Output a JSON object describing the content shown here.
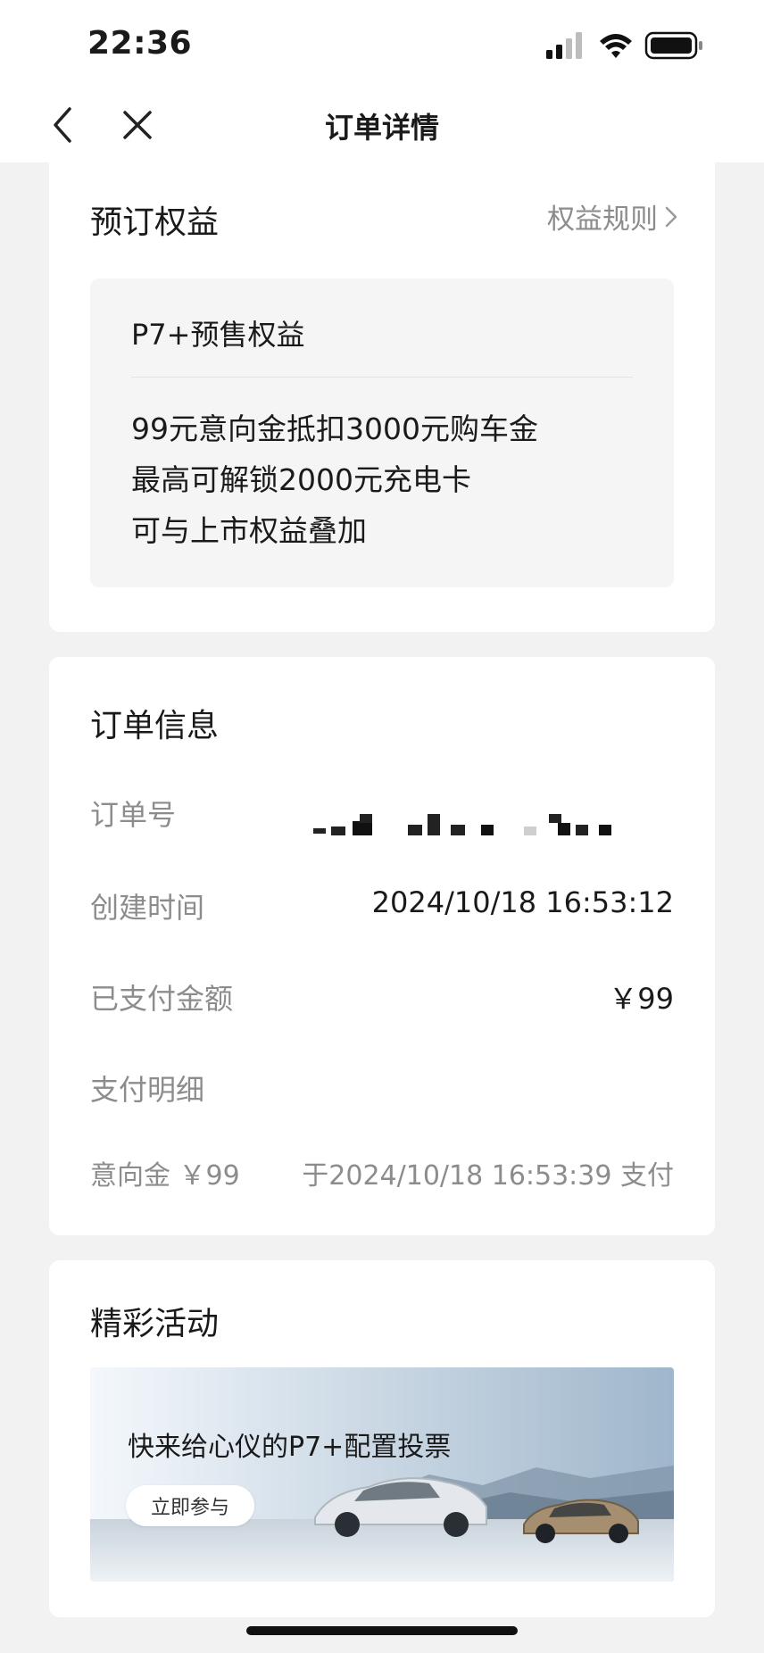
{
  "status_bar": {
    "time": "22:36"
  },
  "nav": {
    "title": "订单详情",
    "back_icon": "chevron-left-icon",
    "close_icon": "close-icon"
  },
  "benefits_card": {
    "title": "预订权益",
    "rules_link": "权益规则",
    "box_title": "P7+预售权益",
    "lines": [
      "99元意向金抵扣3000元购车金",
      "最高可解锁2000元充电卡",
      "可与上市权益叠加"
    ]
  },
  "order_card": {
    "title": "订单信息",
    "order_no_label": "订单号",
    "created_label": "创建时间",
    "created_value": "2024/10/18 16:53:12",
    "paid_label": "已支付金额",
    "paid_value": "￥99",
    "detail_label": "支付明细",
    "detail_item": "意向金 ￥99",
    "detail_time": "于2024/10/18 16:53:39 支付"
  },
  "activity_card": {
    "title": "精彩活动",
    "banner_text": "快来给心仪的P7+配置投票",
    "banner_button": "立即参与"
  }
}
